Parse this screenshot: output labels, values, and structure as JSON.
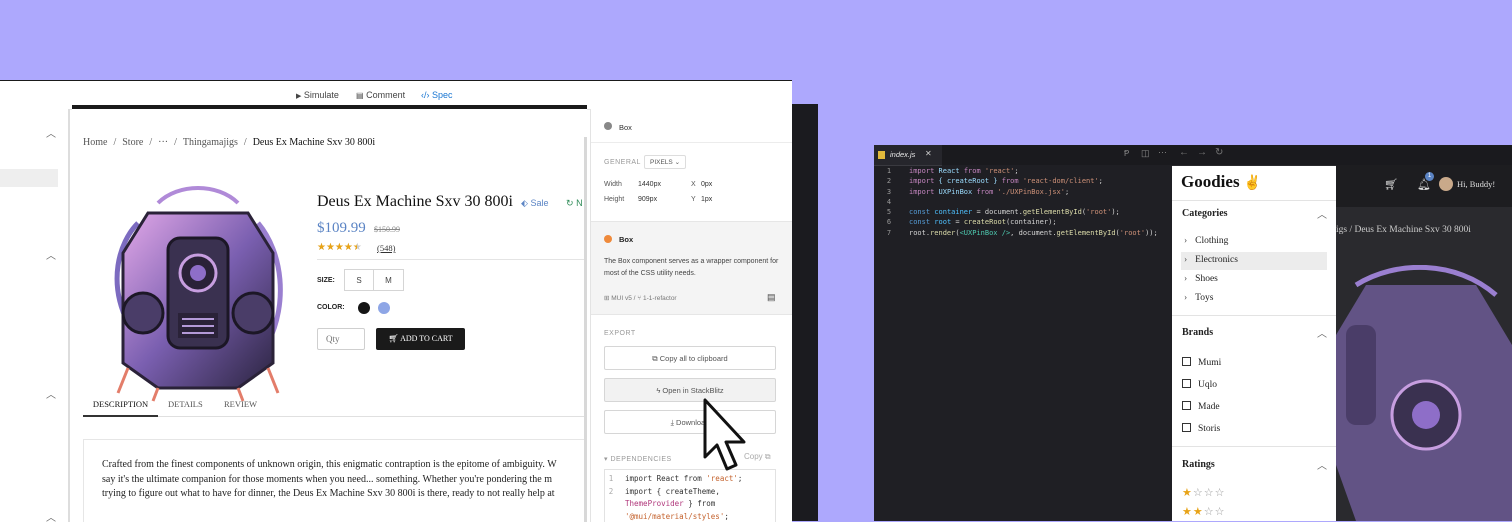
{
  "colors": {
    "background": "#ada8fd",
    "accent": "#1976d2",
    "price": "#5b84c4",
    "star": "#e8a317"
  },
  "topbar": {
    "simulate": "Simulate",
    "comment": "Comment",
    "spec": "Spec"
  },
  "product": {
    "breadcrumb": [
      "Home",
      "/",
      "Store",
      "/",
      "···",
      "/",
      "Thingamajigs",
      "/",
      "Deus Ex Machine Sxv 30 800i"
    ],
    "title": "Deus Ex Machine Sxv 30 800i",
    "sale_label": "Sale",
    "new_label": "N",
    "price": "$109.99",
    "old_price": "$150.99",
    "rating": 4.5,
    "stars": "★★★★★",
    "review_count": "(548)",
    "size_label": "SIZE:",
    "sizes": [
      "S",
      "M"
    ],
    "color_label": "COLOR:",
    "colors": [
      "#151515",
      "#8ea6e6"
    ],
    "qty_placeholder": "Qty",
    "add_to_cart": "ADD TO CART",
    "tabs": [
      "DESCRIPTION",
      "DETAILS",
      "REVIEW"
    ],
    "description": [
      "Crafted from the finest components of unknown origin, this enigmatic contraption is the epitome of ambiguity. W",
      "say it's the ultimate companion for those moments when you need... something. Whether you're pondering the m",
      "trying to figure out what to have for dinner, the Deus Ex Machine Sxv 30 800i is there, ready to not really help at"
    ]
  },
  "spec": {
    "component": "Box",
    "general_label": "GENERAL",
    "units": "PIXELS",
    "width_label": "Width",
    "width_value": "1440px",
    "x_label": "X",
    "x_value": "0px",
    "height_label": "Height",
    "height_value": "909px",
    "y_label": "Y",
    "y_value": "1px",
    "info_title": "Box",
    "info_desc": "The Box component serves as a wrapper component for most of the CSS utility needs.",
    "lib": "MUI v5",
    "branch": "1-1-refactor",
    "export_label": "EXPORT",
    "copy_all": "Copy all to clipboard",
    "open_stackblitz": "Open in StackBlitz",
    "download": "Download",
    "deps_label": "DEPENDENCIES",
    "copy": "Copy",
    "code": [
      {
        "n": "1",
        "parts": [
          [
            "import ",
            "#333"
          ],
          [
            "React",
            "#333"
          ],
          [
            " from ",
            "#333"
          ],
          [
            "'react'",
            "#c4622d"
          ],
          [
            ";",
            "#333"
          ]
        ]
      },
      {
        "n": "2",
        "parts": [
          [
            "import { ",
            "#333"
          ],
          [
            "createTheme",
            "#333"
          ],
          [
            ",",
            "#333"
          ]
        ]
      },
      {
        "n": "",
        "parts": [
          [
            "ThemeProvider",
            "#b0367a"
          ],
          [
            " } from",
            "#333"
          ]
        ]
      },
      {
        "n": "",
        "parts": [
          [
            "'@mui/material/styles'",
            "#c4622d"
          ],
          [
            ";",
            "#333"
          ]
        ]
      }
    ]
  },
  "editor": {
    "tab": "index.js",
    "lines": [
      {
        "n": "1",
        "parts": [
          [
            "import ",
            "#c586c0"
          ],
          [
            "React ",
            "#9cdcfe"
          ],
          [
            "from ",
            "#c586c0"
          ],
          [
            "'react'",
            "#ce9178"
          ],
          [
            ";",
            "#d4d4d4"
          ]
        ]
      },
      {
        "n": "2",
        "parts": [
          [
            "import ",
            "#c586c0"
          ],
          [
            "{ createRoot } ",
            "#9cdcfe"
          ],
          [
            "from ",
            "#c586c0"
          ],
          [
            "'react-dom/client'",
            "#ce9178"
          ],
          [
            ";",
            "#d4d4d4"
          ]
        ]
      },
      {
        "n": "3",
        "parts": [
          [
            "import ",
            "#c586c0"
          ],
          [
            "UXPinBox ",
            "#9cdcfe"
          ],
          [
            "from ",
            "#c586c0"
          ],
          [
            "'./UXPinBox.jsx'",
            "#ce9178"
          ],
          [
            ";",
            "#d4d4d4"
          ]
        ]
      },
      {
        "n": "4",
        "parts": []
      },
      {
        "n": "5",
        "parts": [
          [
            "const ",
            "#569cd6"
          ],
          [
            "container",
            "#4fc1ff"
          ],
          [
            " = document.",
            "#d4d4d4"
          ],
          [
            "getElementById",
            "#dcdcaa"
          ],
          [
            "(",
            "#d4d4d4"
          ],
          [
            "'root'",
            "#ce9178"
          ],
          [
            ");",
            "#d4d4d4"
          ]
        ]
      },
      {
        "n": "6",
        "parts": [
          [
            "const ",
            "#569cd6"
          ],
          [
            "root",
            "#4fc1ff"
          ],
          [
            " = ",
            "#d4d4d4"
          ],
          [
            "createRoot",
            "#dcdcaa"
          ],
          [
            "(container);",
            "#d4d4d4"
          ]
        ]
      },
      {
        "n": "7",
        "parts": [
          [
            "root.",
            "#d4d4d4"
          ],
          [
            "render",
            "#dcdcaa"
          ],
          [
            "(",
            "#d4d4d4"
          ],
          [
            "<UXPinBox />",
            "#4ec9b0"
          ],
          [
            ", document.",
            "#d4d4d4"
          ],
          [
            "getElementById",
            "#dcdcaa"
          ],
          [
            "(",
            "#d4d4d4"
          ],
          [
            "'root'",
            "#ce9178"
          ],
          [
            "));",
            "#d4d4d4"
          ]
        ]
      }
    ]
  },
  "goodies": {
    "logo": "Goodies",
    "logo_icon": "✌",
    "categories_label": "Categories",
    "categories": [
      "Clothing",
      "Electronics",
      "Shoes",
      "Toys"
    ],
    "brands_label": "Brands",
    "brands": [
      "Mumi",
      "Uqlo",
      "Made",
      "Storis"
    ],
    "ratings_label": "Ratings",
    "ratings": [
      1,
      2
    ]
  },
  "goodies_header": {
    "greeting": "Hi, Buddy!",
    "badge": "1",
    "breadcrumb_tail": "igs  /  Deus Ex Machine Sxv 30 800i"
  }
}
